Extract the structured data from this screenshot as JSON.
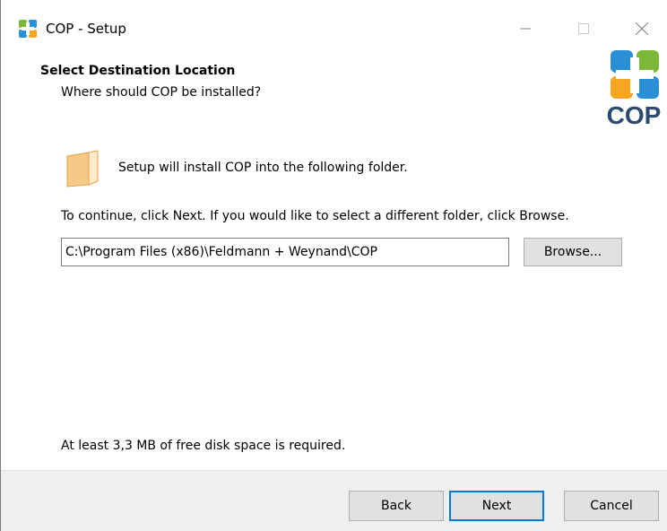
{
  "window": {
    "title": "COP - Setup"
  },
  "header": {
    "title": "Select Destination Location",
    "subtitle": "Where should COP be installed?",
    "logo_text": "COP"
  },
  "content": {
    "intro": "Setup will install COP into the following folder.",
    "instructions": "To continue, click Next. If you would like to select a different folder, click Browse.",
    "path_value": "C:\\Program Files (x86)\\Feldmann + Weynand\\COP",
    "browse_label": "Browse...",
    "space_required": "At least 3,3 MB of free disk space is required."
  },
  "footer": {
    "back_label": "Back",
    "next_label": "Next",
    "cancel_label": "Cancel"
  },
  "colors": {
    "accent": "#0078d7",
    "logo_green": "#7bb83a",
    "logo_blue": "#2b8fd6",
    "logo_orange": "#f5a623",
    "folder": "#f7c987"
  }
}
